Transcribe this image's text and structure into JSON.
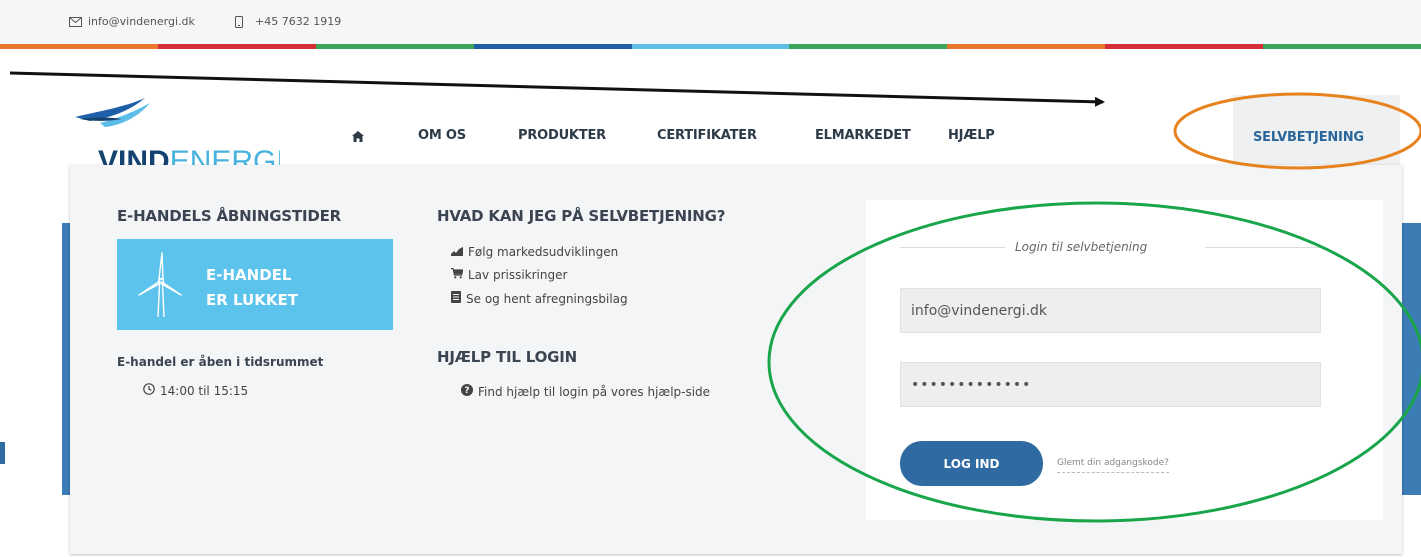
{
  "topbar": {
    "email": "info@vindenergi.dk",
    "phone": "+45 7632 1919",
    "email_icon": "envelope-icon",
    "phone_icon": "mobile-phone-icon",
    "stripe_colors": [
      "#e8772e",
      "#d62e37",
      "#3ba55c",
      "#1f5fa8",
      "#5bbde8",
      "#3ba55c",
      "#e8772e",
      "#d62e37",
      "#3ba55c"
    ]
  },
  "logo": {
    "bold": "VIND",
    "light": "ENERGI"
  },
  "nav": {
    "home_icon": "home-icon",
    "items": [
      "OM OS",
      "PRODUKTER",
      "CERTIFIKATER",
      "ELMARKEDET",
      "HJÆLP"
    ],
    "selvbetjening": "SELVBETJENING"
  },
  "ehandel": {
    "heading": "E-HANDELS ÅBNINGSTIDER",
    "line1": "E-HANDEL",
    "line2": "ER LUKKET",
    "icon": "wind-turbine-icon",
    "open_label": "E-handel er åben i tidsrummet",
    "clock_icon": "clock-icon",
    "time": "14:00 til 15:15"
  },
  "features": {
    "heading": "HVAD KAN JEG PÅ SELVBETJENING?",
    "items": [
      {
        "icon": "area-chart-icon",
        "label": "Følg markedsudviklingen"
      },
      {
        "icon": "shopping-cart-icon",
        "label": "Lav prissikringer"
      },
      {
        "icon": "document-icon",
        "label": "Se og hent afregningsbilag"
      }
    ]
  },
  "help": {
    "heading": "HJÆLP TIL LOGIN",
    "icon": "question-circle-icon",
    "label": "Find hjælp til login på vores hjælp-side"
  },
  "login": {
    "title": "Login til selvbetjening",
    "email_value": "info@vindenergi.dk",
    "password_value": "•••••••••••••",
    "button_label": "LOG IND",
    "forgot_label": "Glemt din adgangskode?"
  },
  "colors": {
    "accent_blue": "#2f6aa3",
    "ehandel_blue": "#5cc4ec",
    "annotation_orange": "#e8821f",
    "annotation_green": "#19a54a"
  }
}
